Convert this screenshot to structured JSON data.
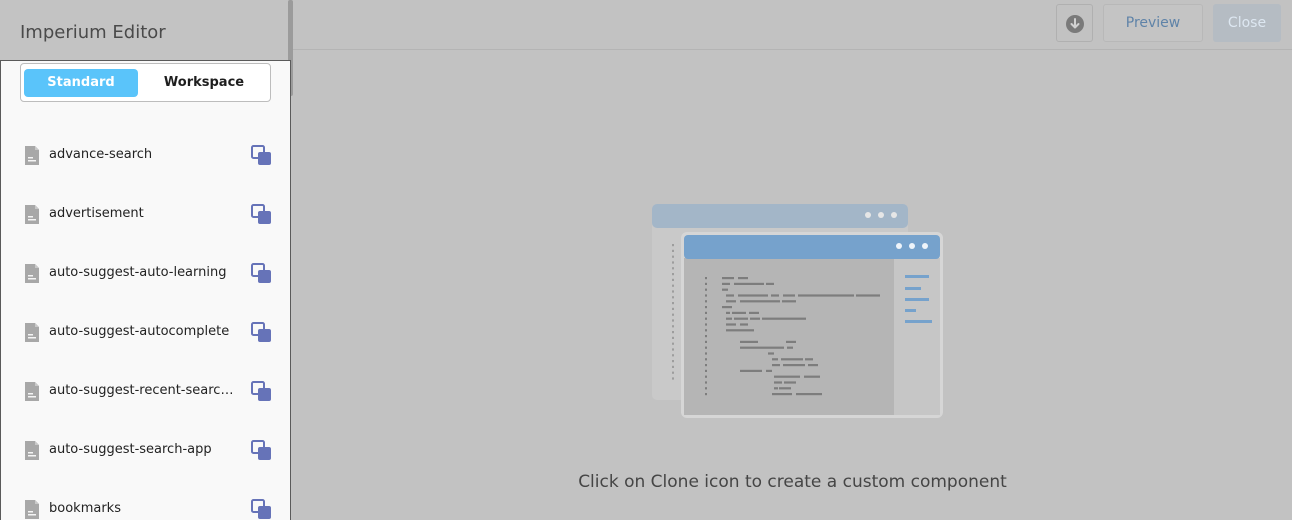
{
  "app": {
    "title": "Imperium Editor"
  },
  "toggle": {
    "standard": "Standard",
    "workspace": "Workspace"
  },
  "components": [
    {
      "label": "advance-search",
      "icon": "file-icon",
      "action_icon": "clone-icon"
    },
    {
      "label": "advertisement",
      "icon": "file-icon",
      "action_icon": "clone-icon"
    },
    {
      "label": "auto-suggest-auto-learning",
      "icon": "file-icon",
      "action_icon": "clone-icon"
    },
    {
      "label": "auto-suggest-autocomplete",
      "icon": "file-icon",
      "action_icon": "clone-icon"
    },
    {
      "label": "auto-suggest-recent-searches",
      "icon": "file-icon",
      "action_icon": "clone-icon"
    },
    {
      "label": "auto-suggest-search-app",
      "icon": "file-icon",
      "action_icon": "clone-icon"
    },
    {
      "label": "bookmarks",
      "icon": "file-icon",
      "action_icon": "clone-icon"
    }
  ],
  "toolbar": {
    "download_icon": "download-icon",
    "preview": "Preview",
    "close": "Close"
  },
  "main": {
    "empty_message": "Click on Clone icon to create a custom component"
  },
  "colors": {
    "accent": "#5ac4fa",
    "clone_icon": "#6673b8",
    "preview_text": "#5f83a8",
    "window_header": "#76a2cc"
  }
}
